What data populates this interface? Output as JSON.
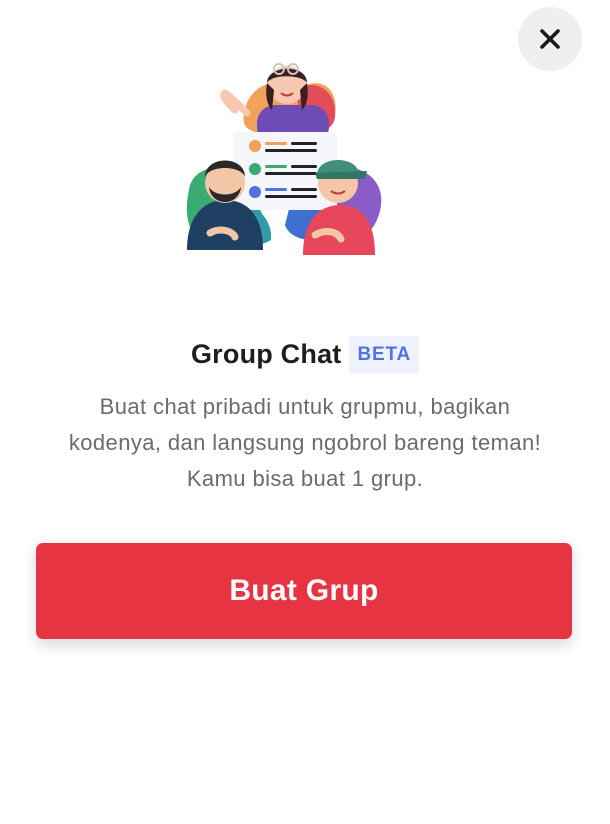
{
  "dialog": {
    "close_icon": "close-icon",
    "title": "Group Chat",
    "badge": "BETA",
    "description_lines": [
      "Buat chat pribadi untuk grupmu, bagikan",
      "kodenya, dan langsung ngobrol bareng teman!",
      "Kamu bisa buat 1 grup."
    ],
    "primary_button_label": "Buat Grup"
  },
  "colors": {
    "primary": "#e63443",
    "badge_text": "#4f73e0",
    "badge_bg": "#eef2fd",
    "close_bg": "#efefef"
  }
}
